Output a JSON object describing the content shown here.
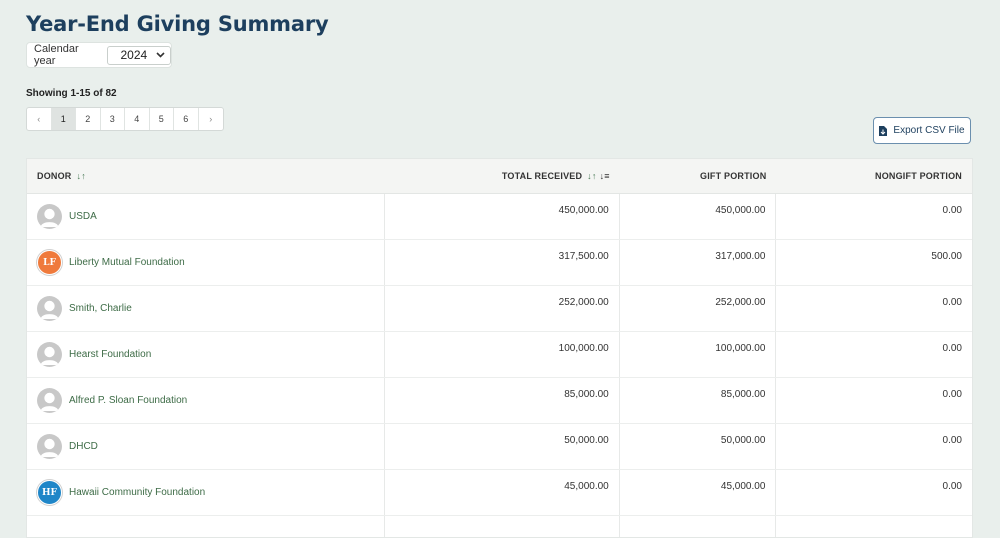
{
  "page": {
    "title": "Year-End Giving Summary",
    "year_label": "Calendar year",
    "year_value": "2024",
    "showing": "Showing 1-15 of 82",
    "export_label": "Export CSV File"
  },
  "pagination": {
    "prev": "‹",
    "next": "›",
    "pages": [
      "1",
      "2",
      "3",
      "4",
      "5",
      "6"
    ],
    "current": "1"
  },
  "table": {
    "headers": {
      "donor": "DONOR",
      "total": "TOTAL RECEIVED",
      "gift": "GIFT PORTION",
      "nongift": "NONGIFT PORTION"
    },
    "rows": [
      {
        "name": "USDA",
        "avatar": "person-icon",
        "initials": "",
        "color": "#c8c8c8",
        "total": "450,000.00",
        "gift": "450,000.00",
        "nongift": "0.00"
      },
      {
        "name": "Liberty Mutual Foundation",
        "avatar": "initials",
        "initials": "LF",
        "color": "#ef7a3c",
        "total": "317,500.00",
        "gift": "317,000.00",
        "nongift": "500.00"
      },
      {
        "name": "Smith, Charlie",
        "avatar": "person-icon",
        "initials": "",
        "color": "#c8c8c8",
        "total": "252,000.00",
        "gift": "252,000.00",
        "nongift": "0.00"
      },
      {
        "name": "Hearst Foundation",
        "avatar": "person-icon",
        "initials": "",
        "color": "#c8c8c8",
        "total": "100,000.00",
        "gift": "100,000.00",
        "nongift": "0.00"
      },
      {
        "name": "Alfred P. Sloan Foundation",
        "avatar": "person-icon",
        "initials": "",
        "color": "#c8c8c8",
        "total": "85,000.00",
        "gift": "85,000.00",
        "nongift": "0.00"
      },
      {
        "name": "DHCD",
        "avatar": "person-icon",
        "initials": "",
        "color": "#c8c8c8",
        "total": "50,000.00",
        "gift": "50,000.00",
        "nongift": "0.00"
      },
      {
        "name": "Hawaii Community Foundation",
        "avatar": "initials",
        "initials": "HF",
        "color": "#1f86c8",
        "total": "45,000.00",
        "gift": "45,000.00",
        "nongift": "0.00"
      },
      {
        "name": "",
        "avatar": "",
        "initials": "",
        "color": "",
        "total": "",
        "gift": "",
        "nongift": ""
      }
    ]
  }
}
